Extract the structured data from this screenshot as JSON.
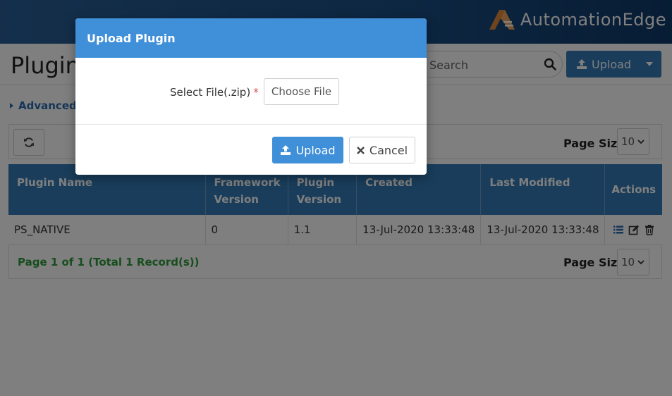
{
  "header": {
    "brand": "AutomationEdge",
    "colors": {
      "bar": "#1c4f86",
      "logo_accent": "#e08a3c"
    }
  },
  "page": {
    "title": "Plugin",
    "search_placeholder": "Search",
    "upload_label": "Upload",
    "advanced_search_label": "Advanced S",
    "page_size_label": "Page Size",
    "page_size_value": "10"
  },
  "table": {
    "columns": [
      {
        "line1": "Plugin Name",
        "line2": ""
      },
      {
        "line1": "Framework",
        "line2": "Version"
      },
      {
        "line1": "Plugin",
        "line2": "Version"
      },
      {
        "line1": "Created",
        "line2": ""
      },
      {
        "line1": "Last Modified",
        "line2": ""
      },
      {
        "line1": "Actions",
        "line2": ""
      }
    ],
    "rows": [
      {
        "name": "PS_NATIVE",
        "framework_version": "0",
        "plugin_version": "1.1",
        "created": "13-Jul-2020 13:33:48",
        "last_modified": "13-Jul-2020 13:33:48"
      }
    ],
    "action_icons": [
      "list-icon",
      "edit-icon",
      "trash-icon"
    ]
  },
  "footer": {
    "page_info": "Page 1 of 1 (Total 1 Record(s))",
    "page_size_label": "Page Size",
    "page_size_value": "10"
  },
  "modal": {
    "title": "Upload Plugin",
    "file_label": "Select File(.zip)",
    "required_marker": "*",
    "choose_file_label": "Choose File",
    "upload_label": "Upload",
    "cancel_label": "Cancel"
  },
  "colors": {
    "primary": "#337ab7",
    "modal_primary": "#3f8fd9",
    "success_text": "#2f9b3a",
    "required": "#d9534f"
  }
}
